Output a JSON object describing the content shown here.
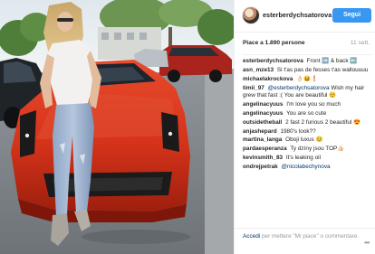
{
  "post": {
    "username": "esterberdychsatorova",
    "follow_label": "Segui",
    "likes_text": "Piace a 1.890 persone",
    "time_text": "11 sett."
  },
  "comments": [
    {
      "user": "esterberdychsatorova",
      "text": "Front ➡️ & back ⬅️",
      "mention": ""
    },
    {
      "user": "asn_mze13",
      "text": "Si t'as pas de fesses t'as wallouuuu",
      "mention": ""
    },
    {
      "user": "michaelakrockova",
      "text": "👌🏻😆❗️",
      "mention": ""
    },
    {
      "user": "timii_97",
      "text": " Wish my hair grew that fast :( You are beautiful ☺️",
      "mention": "@esterberdychsatorova"
    },
    {
      "user": "angelinacyuus",
      "text": "I'm love you so much",
      "mention": ""
    },
    {
      "user": "angelinacyuus",
      "text": "You are so cute",
      "mention": ""
    },
    {
      "user": "outsidetheball",
      "text": "2 fast 2 furious 2 beautiful 😍",
      "mention": ""
    },
    {
      "user": "anjashepard",
      "text": "1980's look??",
      "mention": ""
    },
    {
      "user": "martina_langa",
      "text": "Oboji luxus 😊",
      "mention": ""
    },
    {
      "user": "pardaesperanza",
      "text": "Ty dzíny jsou TOP👍🏻",
      "mention": ""
    },
    {
      "user": "kevinsmith_83",
      "text": "It's leaking oil",
      "mention": ""
    },
    {
      "user": "ondrejpetrak",
      "text": "",
      "mention": "@nicolabechynova"
    }
  ],
  "footer": {
    "link_text": "Accedi",
    "text": " per mettere \"Mi piace\" o commentare.",
    "more_icon": "•••"
  },
  "icons": {
    "more": "more-dots-icon"
  },
  "colors": {
    "follow_button": "#3897f0",
    "link": "#003569",
    "muted": "#999999"
  }
}
